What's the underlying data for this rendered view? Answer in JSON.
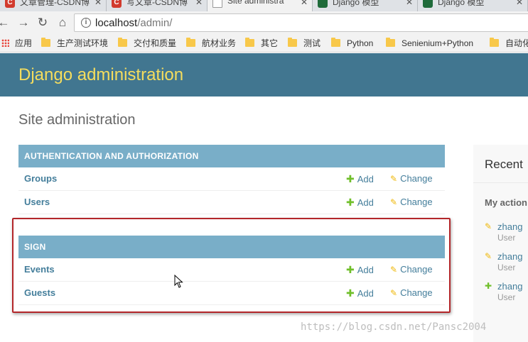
{
  "browser": {
    "tabs": [
      {
        "title": "文章管理-CSDN博",
        "icon": "csdn-icon",
        "active": false
      },
      {
        "title": "写文章-CSDN博",
        "icon": "csdn-icon",
        "active": false
      },
      {
        "title": "Site administra",
        "icon": "page-icon",
        "active": true
      },
      {
        "title": "Django 模型",
        "icon": "django-icon",
        "active": false
      },
      {
        "title": "Django 模型",
        "icon": "django-icon",
        "active": false
      }
    ],
    "url_host": "localhost",
    "url_path": "/admin/",
    "bookmarks": [
      {
        "label": "应用",
        "icon": "apps-icon"
      },
      {
        "label": "生产测试环境",
        "icon": "folder-icon"
      },
      {
        "label": "交付和质量",
        "icon": "folder-icon"
      },
      {
        "label": "航材业务",
        "icon": "folder-icon"
      },
      {
        "label": "其它",
        "icon": "folder-icon"
      },
      {
        "label": "测试",
        "icon": "folder-icon"
      },
      {
        "label": "Python",
        "icon": "folder-icon"
      },
      {
        "label": "Senienium+Python",
        "icon": "folder-icon"
      },
      {
        "label": "自动化",
        "icon": "folder-icon"
      }
    ]
  },
  "header": {
    "brand": "Django administration"
  },
  "page_title": "Site administration",
  "modules": [
    {
      "caption": "Authentication and Authorization",
      "rows": [
        {
          "model": "Groups",
          "add": "Add",
          "change": "Change"
        },
        {
          "model": "Users",
          "add": "Add",
          "change": "Change"
        }
      ]
    },
    {
      "caption": "Sign",
      "rows": [
        {
          "model": "Events",
          "add": "Add",
          "change": "Change"
        },
        {
          "model": "Guests",
          "add": "Add",
          "change": "Change"
        }
      ]
    }
  ],
  "recent": {
    "title": "Recent",
    "my_actions": "My action",
    "entries": [
      {
        "name": "zhang",
        "type": "User",
        "icon": "pencil-icon"
      },
      {
        "name": "zhang",
        "type": "User",
        "icon": "pencil-icon"
      },
      {
        "name": "zhang",
        "type": "User",
        "icon": "plus-icon"
      }
    ]
  },
  "watermark": "https://blog.csdn.net/Pansc2004",
  "colors": {
    "header_bg": "#417690",
    "brand": "#f5dd5d",
    "caption_bg": "#79aec8",
    "link": "#447e9b",
    "add_green": "#70bf2b",
    "change_yellow": "#efb80b",
    "highlight_red": "#b3262a"
  }
}
